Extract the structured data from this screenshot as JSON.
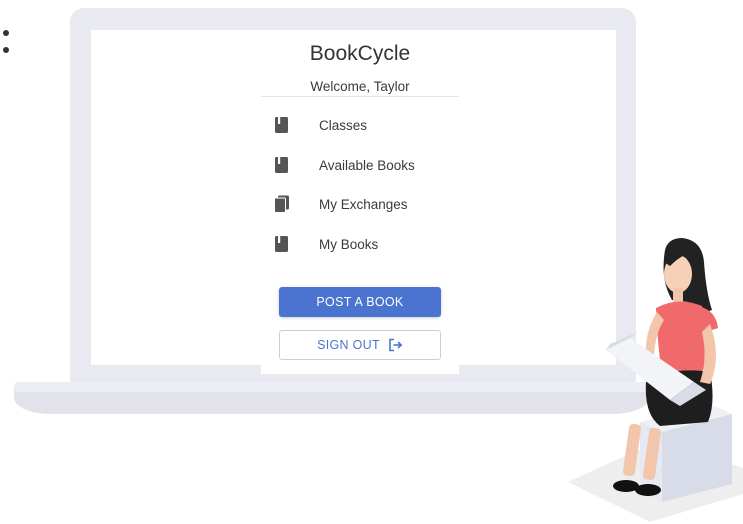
{
  "app": {
    "title": "BookCycle",
    "welcome": "Welcome, Taylor"
  },
  "menu": {
    "items": [
      {
        "label": "Classes",
        "icon": "book-icon"
      },
      {
        "label": "Available Books",
        "icon": "book-icon"
      },
      {
        "label": "My Exchanges",
        "icon": "books-stack-icon"
      },
      {
        "label": "My Books",
        "icon": "book-icon"
      }
    ]
  },
  "actions": {
    "post_label": "POST A BOOK",
    "signout_label": "SIGN OUT",
    "signout_icon": "sign-out-icon"
  },
  "colors": {
    "accent": "#4a74cf",
    "laptop_frame": "#e8e9f1",
    "icon": "#555555"
  }
}
